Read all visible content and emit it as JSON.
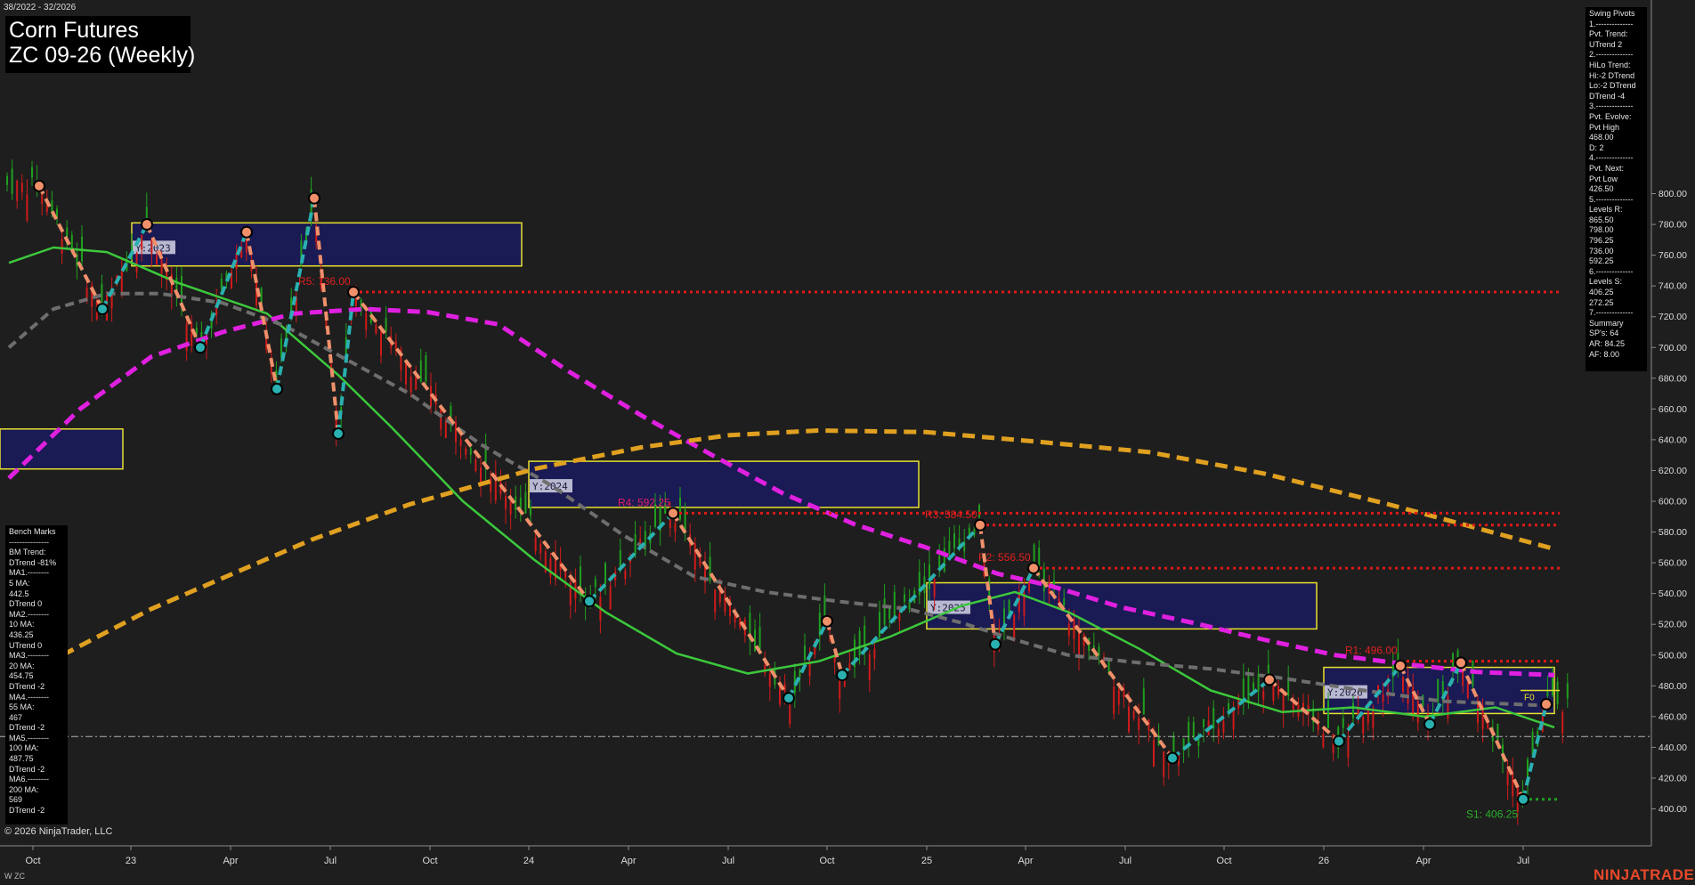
{
  "header": {
    "date_range": "38/2022 - 32/2026",
    "title_line1": "Corn Futures",
    "title_line2": "ZC 09-26 (Weekly)"
  },
  "footer": {
    "copyright": "© 2026 NinjaTrader, LLC",
    "instrument": "W ZC",
    "brand": "NINJATRADER"
  },
  "swing_panel": {
    "lines": [
      "Swing Pivots",
      "1.--------------",
      "Pvt. Trend:",
      "UTrend 2",
      "2.--------------",
      "HiLo Trend:",
      "Hi:-2 DTrend",
      "Lo:-2 DTrend",
      "DTrend -4",
      "3.--------------",
      "Pvt. Evolve:",
      "Pvt High",
      "468.00",
      "D: 2",
      "4.--------------",
      "Pvt. Next:",
      "Pvt Low",
      "426.50",
      "5.--------------",
      "Levels R:",
      "865.50",
      "798.00",
      "796.25",
      "736.00",
      "592.25",
      "6.--------------",
      "Levels S:",
      "406.25",
      "272.25",
      "7.--------------",
      "Summary",
      "SP's: 64",
      "AR: 84.25",
      "AF: 8.00"
    ]
  },
  "bench_panel": {
    "lines": [
      "Bench Marks",
      "---------------",
      "BM Trend:",
      "DTrend -81%",
      "MA1.--------",
      "5 MA:",
      "442.5",
      "DTrend 0",
      "MA2.--------",
      "10 MA:",
      "436.25",
      "UTrend 0",
      "MA3.--------",
      "20 MA:",
      "454.75",
      "DTrend -2",
      "MA4.--------",
      "55 MA:",
      "467",
      "DTrend -2",
      "MA5.--------",
      "100 MA:",
      "487.75",
      "DTrend -2",
      "MA6.--------",
      "200 MA:",
      "569",
      "DTrend -2"
    ]
  },
  "colors": {
    "background": "#1e1e1e",
    "bull_candle": "#1fa01f",
    "bear_candle": "#d01a1a",
    "ma_green": "#3cc83c",
    "ma_gray": "#6e6e6e",
    "ma_magenta": "#e020e0",
    "ma_orange": "#e0a020",
    "swing_up": "#2ab0b0",
    "swing_down": "#f0906a",
    "resistance": "#e01818",
    "support": "#20a020",
    "year_box_fill": "#1a1a5a",
    "year_box_border": "#e8e030"
  },
  "chart_data": {
    "type": "candlestick",
    "instrument": "ZC 09-26 (Weekly)",
    "y_axis": {
      "ylim": [
        390,
        830
      ],
      "ticks": [
        400,
        420,
        440,
        460,
        480,
        500,
        520,
        540,
        560,
        580,
        600,
        620,
        640,
        660,
        680,
        700,
        720,
        740,
        760,
        780,
        800
      ]
    },
    "x_axis": {
      "tick_labels": [
        "Oct",
        "23",
        "Apr",
        "Jul",
        "Oct",
        "24",
        "Apr",
        "Jul",
        "Oct",
        "25",
        "Apr",
        "Jul",
        "Oct",
        "26",
        "Apr",
        "Jul"
      ]
    },
    "swing_points": [
      {
        "t": "2022-10",
        "v": 805
      },
      {
        "t": "2022-12",
        "v": 725
      },
      {
        "t": "2023-01",
        "v": 780
      },
      {
        "t": "2023-03",
        "v": 700
      },
      {
        "t": "2023-04",
        "v": 775
      },
      {
        "t": "2023-05",
        "v": 673
      },
      {
        "t": "2023-06",
        "v": 797
      },
      {
        "t": "2023-07",
        "v": 644
      },
      {
        "t": "2023-07b",
        "v": 736
      },
      {
        "t": "2024-02",
        "v": 535
      },
      {
        "t": "2024-05",
        "v": 592.25
      },
      {
        "t": "2024-08",
        "v": 472
      },
      {
        "t": "2024-10",
        "v": 522
      },
      {
        "t": "2024-11",
        "v": 487
      },
      {
        "t": "2025-02",
        "v": 584.5
      },
      {
        "t": "2025-03",
        "v": 507
      },
      {
        "t": "2025-04",
        "v": 556.5
      },
      {
        "t": "2025-08",
        "v": 433
      },
      {
        "t": "2025-11",
        "v": 484
      },
      {
        "t": "2026-01",
        "v": 444
      },
      {
        "t": "2026-03",
        "v": 493
      },
      {
        "t": "2026-04",
        "v": 455
      },
      {
        "t": "2026-05",
        "v": 495
      },
      {
        "t": "2026-07",
        "v": 406.25
      },
      {
        "t": "2026-08",
        "v": 468
      }
    ],
    "levels": [
      {
        "label": "R5: 736.00",
        "value": 736,
        "type": "resistance"
      },
      {
        "label": "R4: 592.25",
        "value": 592.25,
        "type": "resistance"
      },
      {
        "label": "R3: 584.50",
        "value": 584.5,
        "type": "resistance"
      },
      {
        "label": "R2: 556.50",
        "value": 556.5,
        "type": "resistance"
      },
      {
        "label": "R1: 496.00",
        "value": 496,
        "type": "resistance"
      },
      {
        "label": "S1: 406.25",
        "value": 406.25,
        "type": "support"
      }
    ],
    "current_price_line": 447,
    "year_boxes": [
      {
        "label": "Y:2023",
        "high": 781,
        "low": 753
      },
      {
        "label": "",
        "high": 647,
        "low": 621
      },
      {
        "label": "Y:2024",
        "high": 626,
        "low": 596
      },
      {
        "label": "Y:2025",
        "high": 547,
        "low": 517
      },
      {
        "label": "Y:2026",
        "high": 492,
        "low": 462
      }
    ],
    "marker_label": "F0",
    "moving_averages": [
      {
        "name": "20 MA",
        "color": "#3cc83c",
        "dashed": false,
        "values": [
          755,
          765,
          762,
          742,
          722,
          682,
          648,
          600,
          562,
          528,
          501,
          488,
          496,
          512,
          532,
          541,
          528,
          504,
          477,
          463,
          466,
          460,
          466,
          453
        ]
      },
      {
        "name": "55 MA",
        "color": "#6e6e6e",
        "dashed": true,
        "values": [
          700,
          725,
          735,
          735,
          729,
          714,
          695,
          670,
          637,
          610,
          578,
          551,
          541,
          535,
          530,
          521,
          510,
          500,
          495,
          491,
          485,
          478,
          470,
          467
        ]
      },
      {
        "name": "100 MA",
        "color": "#e020e0",
        "dashed": true,
        "values": [
          615,
          660,
          694,
          710,
          722,
          725,
          723,
          715,
          684,
          656,
          630,
          605,
          585,
          570,
          553,
          545,
          531,
          521,
          510,
          500,
          494,
          489,
          487
        ]
      },
      {
        "name": "200 MA",
        "color": "#e0a020",
        "dashed": true,
        "values": [
          500,
          530,
          555,
          575,
          598,
          621,
          635,
          643,
          646,
          645,
          639,
          632,
          618,
          598,
          569
        ]
      }
    ]
  }
}
